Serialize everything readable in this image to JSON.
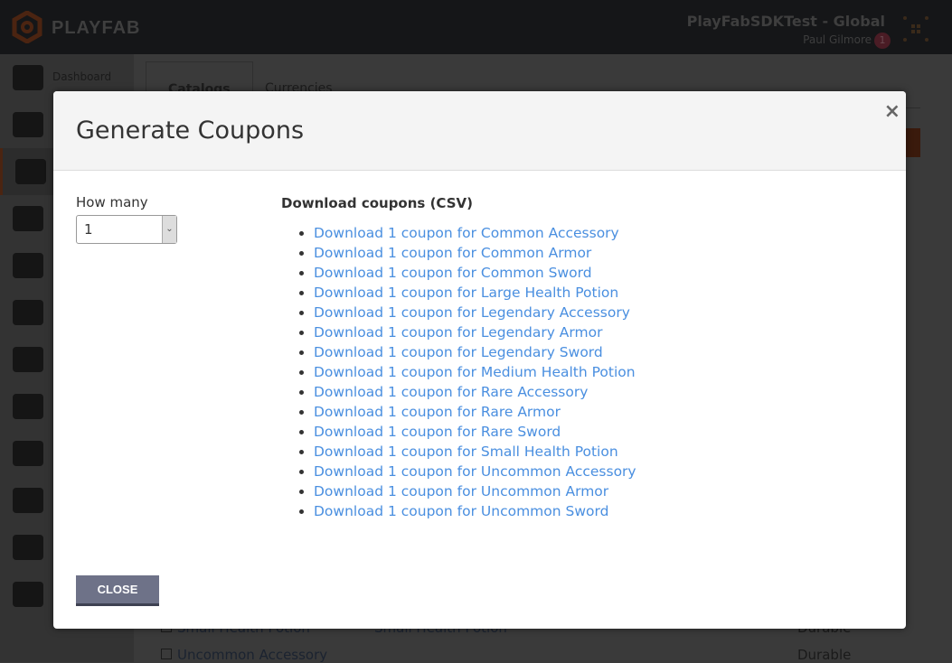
{
  "app": {
    "logo_text": "PLAYFAB",
    "title": "PlayFabSDKTest - Global",
    "user": "Paul Gilmore",
    "notifications": "1",
    "brand_color": "#4b2411"
  },
  "sidebar": {
    "items": [
      {
        "label": "Dashboard",
        "icon": "dashboard-icon"
      },
      {
        "icon": "players-icon"
      },
      {
        "icon": "economy-icon",
        "active": true
      },
      {
        "icon": "leaderboards-icon"
      },
      {
        "icon": "multiplayer-icon"
      },
      {
        "icon": "content-icon"
      },
      {
        "icon": "automation-icon"
      },
      {
        "icon": "analytics-icon"
      },
      {
        "icon": "addons-icon"
      },
      {
        "icon": "settings-icon"
      },
      {
        "icon": "admin-icon"
      },
      {
        "icon": "help-icon"
      }
    ]
  },
  "tabs": [
    {
      "label": "Catalogs",
      "active": true
    },
    {
      "label": "Currencies"
    }
  ],
  "background_rows": [
    {
      "name": "Small Health Potion",
      "display": "Small Health Potion",
      "type": "Durable"
    },
    {
      "name": "Uncommon Accessory",
      "display": "",
      "type": "Durable"
    }
  ],
  "modal": {
    "title": "Generate Coupons",
    "how_many_label": "How many",
    "how_many_value": "1",
    "download_title": "Download coupons (CSV)",
    "links": [
      "Download 1 coupon for Common Accessory",
      "Download 1 coupon for Common Armor",
      "Download 1 coupon for Common Sword",
      "Download 1 coupon for Large Health Potion",
      "Download 1 coupon for Legendary Accessory",
      "Download 1 coupon for Legendary Armor",
      "Download 1 coupon for Legendary Sword",
      "Download 1 coupon for Medium Health Potion",
      "Download 1 coupon for Rare Accessory",
      "Download 1 coupon for Rare Armor",
      "Download 1 coupon for Rare Sword",
      "Download 1 coupon for Small Health Potion",
      "Download 1 coupon for Uncommon Accessory",
      "Download 1 coupon for Uncommon Armor",
      "Download 1 coupon for Uncommon Sword"
    ],
    "close_label": "CLOSE",
    "close_x": "×",
    "link_color": "#4a8fe0"
  }
}
